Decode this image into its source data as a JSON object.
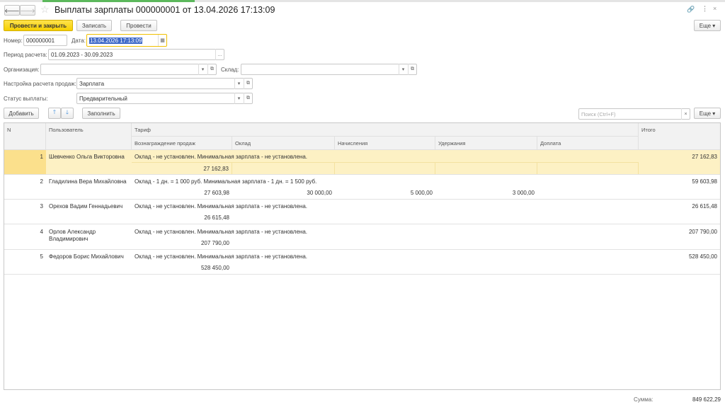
{
  "window": {
    "title": "Выплаты зарплаты 000000001 от 13.04.2026 17:13:09"
  },
  "toolbar": {
    "post_close": "Провести и закрыть",
    "save": "Записать",
    "post": "Провести",
    "more": "Еще ▾"
  },
  "form": {
    "number_label": "Номер:",
    "number": "000000001",
    "date_label": "Дата:",
    "date": "13.04.2026 17:13:09",
    "period_label": "Период расчета:",
    "period": "01.09.2023 - 30.09.2023",
    "org_label": "Организация:",
    "org": "",
    "warehouse_label": "Склад:",
    "warehouse": "",
    "sales_setting_label": "Настройка расчета продаж:",
    "sales_setting": "Зарплата",
    "status_label": "Статус выплаты:",
    "status": "Предварительный"
  },
  "table_toolbar": {
    "add": "Добавить",
    "fill": "Заполнить",
    "search_placeholder": "Поиск (Ctrl+F)",
    "more": "Еще ▾"
  },
  "table": {
    "headers": {
      "n": "N",
      "user": "Пользователь",
      "tariff": "Тариф",
      "reward": "Вознаграждение продаж",
      "salary": "Оклад",
      "accruals": "Начисления",
      "deductions": "Удержания",
      "surcharge": "Доплата",
      "total": "Итого"
    },
    "rows": [
      {
        "n": "1",
        "user": "Шевченко Ольга Викторовна",
        "tariff": "Оклад - не установлен. Минимальная зарплата - не установлена.",
        "reward": "27 162,83",
        "salary": "",
        "accruals": "",
        "deductions": "",
        "surcharge": "",
        "total": "27 162,83",
        "selected": true
      },
      {
        "n": "2",
        "user": "Гладилина Вера Михайловна",
        "tariff": "Оклад - 1 дн. = 1 000 руб. Минимальная зарплата - 1 дн. = 1 500 руб.",
        "reward": "27 603,98",
        "salary": "30 000,00",
        "accruals": "5 000,00",
        "deductions": "3 000,00",
        "surcharge": "",
        "total": "59 603,98"
      },
      {
        "n": "3",
        "user": "Орехов Вадим Геннадьевич",
        "tariff": "Оклад - не установлен. Минимальная зарплата - не установлена.",
        "reward": "26 615,48",
        "salary": "",
        "accruals": "",
        "deductions": "",
        "surcharge": "",
        "total": "26 615,48"
      },
      {
        "n": "4",
        "user": "Орлов Александр Владимирович",
        "tariff": "Оклад - не установлен. Минимальная зарплата - не установлена.",
        "reward": "207 790,00",
        "salary": "",
        "accruals": "",
        "deductions": "",
        "surcharge": "",
        "total": "207 790,00"
      },
      {
        "n": "5",
        "user": "Федоров Борис Михайлович",
        "tariff": "Оклад - не установлен. Минимальная зарплата - не установлена.",
        "reward": "528 450,00",
        "salary": "",
        "accruals": "",
        "deductions": "",
        "surcharge": "",
        "total": "528 450,00"
      }
    ]
  },
  "footer": {
    "sum_label": "Сумма:",
    "sum": "849 622,29"
  },
  "colors": {
    "primary": "#f5cf00",
    "selected_row": "#fdf1c4",
    "focus_border": "#f0c000"
  }
}
